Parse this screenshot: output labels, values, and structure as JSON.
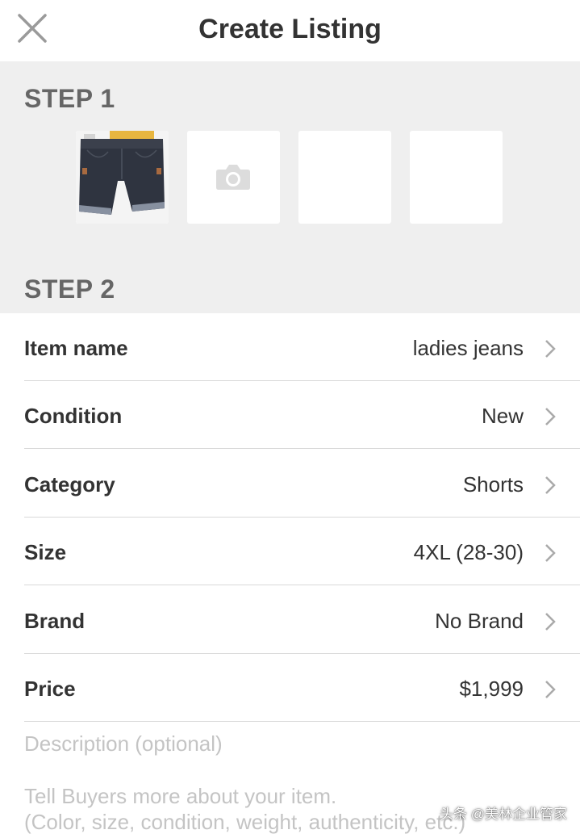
{
  "header": {
    "title": "Create Listing",
    "close_icon": "close-icon"
  },
  "step1": {
    "label": "STEP 1",
    "photos": [
      {
        "icon": "photo-thumbnail",
        "filled": true
      },
      {
        "icon": "camera-icon",
        "filled": false
      },
      {
        "icon": "",
        "filled": false
      },
      {
        "icon": "",
        "filled": false
      }
    ]
  },
  "step2": {
    "label": "STEP 2",
    "fields": [
      {
        "label": "Item name",
        "value": "ladies jeans"
      },
      {
        "label": "Condition",
        "value": "New"
      },
      {
        "label": "Category",
        "value": "Shorts"
      },
      {
        "label": "Size",
        "value": "4XL (28-30)"
      },
      {
        "label": "Brand",
        "value": "No Brand"
      },
      {
        "label": "Price",
        "value": "$1,999"
      }
    ]
  },
  "description": {
    "label": "Description (optional)",
    "placeholder": "Tell Buyers more about your item.\n(Color, size, condition, weight, authenticity, etc.)"
  },
  "watermark": "头条 @美林企业管家",
  "colors": {
    "background_grey": "#efefef",
    "text_dark": "#333333",
    "text_step": "#666666",
    "placeholder": "#c4c4c4",
    "divider": "#d9d9d9",
    "chevron": "#aaaaaa"
  }
}
